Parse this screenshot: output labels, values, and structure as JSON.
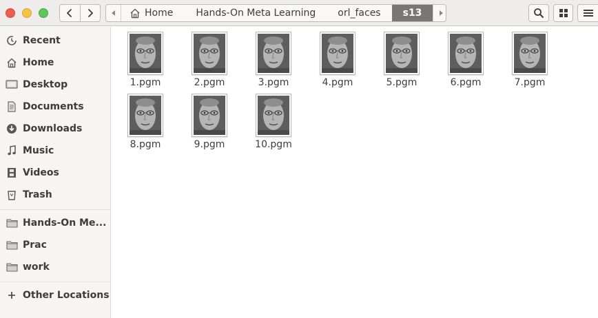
{
  "window": {
    "controls": [
      "close-icon",
      "minimize-icon",
      "maximize-icon"
    ]
  },
  "nav": {
    "back_icon": "chevron-left-icon",
    "forward_icon": "chevron-right-icon"
  },
  "path": {
    "home_icon": "home-icon",
    "crumbs": [
      "Home",
      "Hands-On Meta Learning",
      "orl_faces",
      "s13"
    ],
    "active_index": 3
  },
  "toolbar": {
    "search_icon": "search-icon",
    "view_icon": "grid-view-icon",
    "menu_icon": "menu-icon"
  },
  "sidebar": {
    "items": [
      {
        "label": "Recent",
        "icon": "clock-icon"
      },
      {
        "label": "Home",
        "icon": "home-icon"
      },
      {
        "label": "Desktop",
        "icon": "desktop-icon"
      },
      {
        "label": "Documents",
        "icon": "documents-icon"
      },
      {
        "label": "Downloads",
        "icon": "download-icon"
      },
      {
        "label": "Music",
        "icon": "music-icon"
      },
      {
        "label": "Videos",
        "icon": "video-icon"
      },
      {
        "label": "Trash",
        "icon": "trash-icon"
      }
    ],
    "bookmarks": [
      {
        "label": "Hands-On Me...",
        "icon": "folder-icon"
      },
      {
        "label": "Prac",
        "icon": "folder-icon"
      },
      {
        "label": "work",
        "icon": "folder-icon"
      }
    ],
    "other": {
      "label": "Other Locations",
      "icon": "plus-icon"
    }
  },
  "files": [
    {
      "name": "1.pgm"
    },
    {
      "name": "2.pgm"
    },
    {
      "name": "3.pgm"
    },
    {
      "name": "4.pgm"
    },
    {
      "name": "5.pgm"
    },
    {
      "name": "6.pgm"
    },
    {
      "name": "7.pgm"
    },
    {
      "name": "8.pgm"
    },
    {
      "name": "9.pgm"
    },
    {
      "name": "10.pgm"
    }
  ],
  "colors": {
    "active_crumb_bg": "#7a7673",
    "sidebar_bg": "#f6f5f4",
    "close": "#ec5e4f",
    "minimize": "#f6c444",
    "maximize": "#5ec65c"
  }
}
